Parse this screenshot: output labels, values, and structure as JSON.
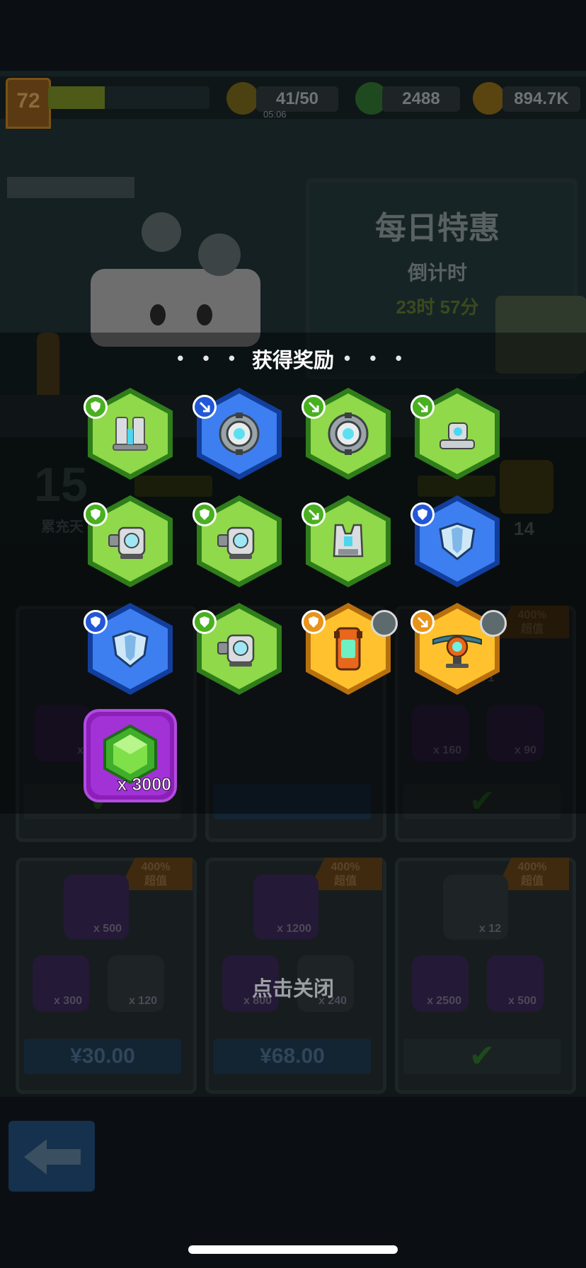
{
  "hud": {
    "level": "72",
    "xp_progress": 0.35,
    "energy": "41/50",
    "energy_timer": "05:06",
    "gems": "2488",
    "coins": "894.7K"
  },
  "daily_deal": {
    "title": "每日特惠",
    "countdown_label": "倒计时",
    "countdown": "23时 57分"
  },
  "stats": {
    "cumulative_value": "15",
    "cumulative_label": "累充天",
    "day_count": "14"
  },
  "shop": {
    "ribbon_line1": "400%",
    "ribbon_line2": "超值",
    "row1": [
      {
        "slot_labels": [
          "x 160",
          "x 90"
        ],
        "claimed": true
      }
    ],
    "row1_card3_top": "x 1",
    "row1_card1_small": "x",
    "row2": [
      {
        "top": "x 500",
        "small": [
          "x 300",
          "x 120"
        ],
        "price": "¥30.00"
      },
      {
        "top": "x 1200",
        "small": [
          "x 800",
          "x 240"
        ],
        "price": "¥68.00"
      },
      {
        "top": "x 12",
        "small": [
          "x 2500",
          "x 500"
        ],
        "price": ""
      }
    ]
  },
  "reward": {
    "title": "获得奖励",
    "title_dots": "• • •",
    "items": [
      {
        "rarity": "green",
        "badge": "shield",
        "icon": "twin-barrier-icon"
      },
      {
        "rarity": "blue",
        "badge": "arrow",
        "icon": "ring-lens-icon"
      },
      {
        "rarity": "green",
        "badge": "arrow",
        "icon": "ring-lens-icon"
      },
      {
        "rarity": "green",
        "badge": "arrow",
        "icon": "turret-base-icon"
      },
      {
        "rarity": "green",
        "badge": "shield",
        "icon": "camera-block-icon"
      },
      {
        "rarity": "green",
        "badge": "shield",
        "icon": "camera-block-icon"
      },
      {
        "rarity": "green",
        "badge": "arrow",
        "icon": "armor-vest-icon"
      },
      {
        "rarity": "blue",
        "badge": "shield",
        "icon": "shield-plate-icon"
      },
      {
        "rarity": "blue",
        "badge": "shield",
        "icon": "shield-plate-icon"
      },
      {
        "rarity": "green",
        "badge": "shield",
        "icon": "camera-block-icon"
      },
      {
        "rarity": "gold",
        "badge": "shield",
        "icon": "orange-generator-icon",
        "corner": "leaf-icon"
      },
      {
        "rarity": "gold",
        "badge": "arrow",
        "icon": "satellite-dish-icon",
        "corner": "drill-icon"
      }
    ],
    "gem_quantity": "x 3000"
  },
  "tap_to_close": "点击关闭",
  "colors": {
    "green_hex": "#8fd94a",
    "blue_hex": "#3d7ff0",
    "gold_hex": "#ffc22e",
    "gem_frame": "#a232d6"
  }
}
